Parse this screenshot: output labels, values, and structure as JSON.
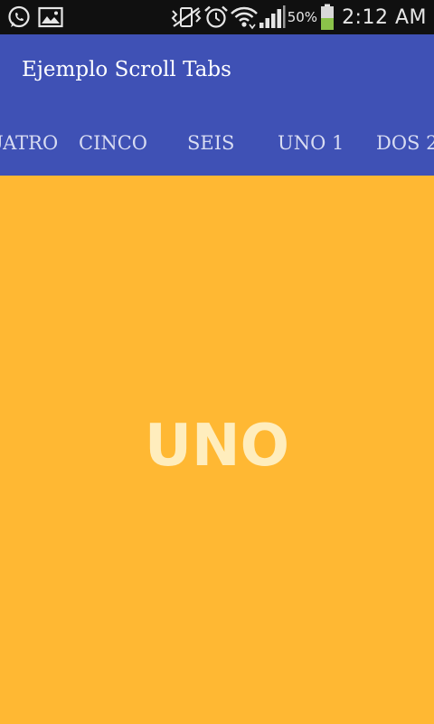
{
  "status_bar": {
    "left_icons": [
      "whatsapp-icon",
      "gallery-icon"
    ],
    "right_icons": [
      "vibrate-icon",
      "alarm-icon",
      "wifi-icon",
      "signal-icon",
      "battery-icon"
    ],
    "battery_percent": "50%",
    "battery_level": 0.5,
    "time": "2:12 AM"
  },
  "app_bar": {
    "title": "Ejemplo Scroll Tabs",
    "color": "#3f51b5"
  },
  "tabs": {
    "items": [
      {
        "label": "CUATRO"
      },
      {
        "label": "CINCO"
      },
      {
        "label": "SEIS"
      },
      {
        "label": "UNO 1"
      },
      {
        "label": "DOS 2"
      }
    ]
  },
  "content": {
    "label": "UNO",
    "background": "#ffb833"
  }
}
